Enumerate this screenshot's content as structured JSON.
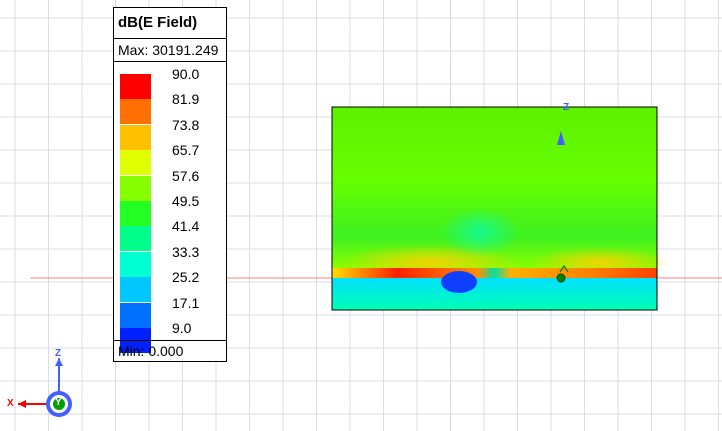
{
  "legend": {
    "title": "dB(E Field)",
    "max_label": "Max: 30191.249",
    "min_label": "Min:  0.000",
    "ticks": [
      "90.0",
      "81.9",
      "73.8",
      "65.7",
      "57.6",
      "49.5",
      "41.4",
      "33.3",
      "25.2",
      "17.1",
      "9.0"
    ],
    "colors": [
      "#ff0000",
      "#ff7000",
      "#ffc000",
      "#e0ff00",
      "#88ff00",
      "#22ff22",
      "#00ff88",
      "#00ffd0",
      "#00c8ff",
      "#0070ff",
      "#0020ff"
    ]
  },
  "axes": {
    "x_label": "X",
    "y_label": "Y",
    "z_label": "Z",
    "x_color": "#ff0000",
    "y_color": "#00a000",
    "z_color": "#4060ff"
  },
  "plot": {
    "background_color": "#66ff00",
    "icons": [
      "z-axis-marker-icon",
      "y-axis-marker-icon",
      "orientation-triad-icon"
    ]
  }
}
